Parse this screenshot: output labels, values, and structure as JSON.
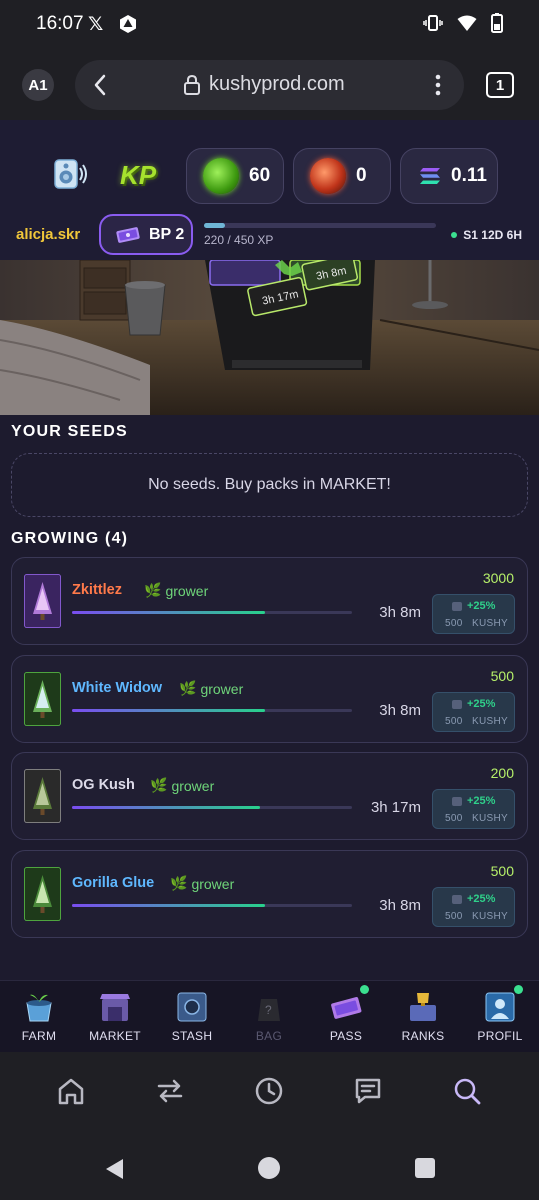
{
  "status_bar": {
    "time": "16:07",
    "x_icon": "x-icon"
  },
  "browser": {
    "profile": "A1",
    "url": "kushyprod.com",
    "tab_count": "1"
  },
  "header": {
    "logo_text": "KP",
    "currencies": [
      {
        "icon": "kp-green-coin",
        "value": "60"
      },
      {
        "icon": "kp-red-coin",
        "value": "0"
      },
      {
        "icon": "solana-icon",
        "value": "0.11"
      }
    ],
    "username": "alicja.skr",
    "bp_label": "BP 2",
    "xp_text": "220 / 450 XP",
    "xp_progress": 0.0888,
    "season": "S1 12D 6H"
  },
  "banner": {
    "tile_1": "3h 17m",
    "tile_2": "3h 8m"
  },
  "seeds": {
    "title": "YOUR SEEDS",
    "empty_message": "No seeds. Buy packs in MARKET!"
  },
  "growing": {
    "title": "GROWING (4)",
    "items": [
      {
        "name": "Zkittlez",
        "name_color": "#ff7a4a",
        "role": "grower",
        "time": "3h 8m",
        "reward": "3000",
        "boost_pct": "+25%",
        "boost_amount": "500",
        "boost_unit": "KUSHY",
        "progress": 0.69
      },
      {
        "name": "White Widow",
        "name_color": "#5fb8ff",
        "role": "grower",
        "time": "3h 8m",
        "reward": "500",
        "boost_pct": "+25%",
        "boost_amount": "500",
        "boost_unit": "KUSHY",
        "progress": 0.69
      },
      {
        "name": "OG Kush",
        "name_color": "#dcdae8",
        "role": "grower",
        "time": "3h 17m",
        "reward": "200",
        "boost_pct": "+25%",
        "boost_amount": "500",
        "boost_unit": "KUSHY",
        "progress": 0.67
      },
      {
        "name": "Gorilla Glue",
        "name_color": "#5fb8ff",
        "role": "grower",
        "time": "3h 8m",
        "reward": "500",
        "boost_pct": "+25%",
        "boost_amount": "500",
        "boost_unit": "KUSHY",
        "progress": 0.69
      }
    ]
  },
  "nav": {
    "items": [
      {
        "label": "FARM",
        "icon": "farm-icon",
        "active": true
      },
      {
        "label": "MARKET",
        "icon": "market-icon"
      },
      {
        "label": "STASH",
        "icon": "stash-icon"
      },
      {
        "label": "BAG",
        "icon": "bag-icon",
        "disabled": true
      },
      {
        "label": "PASS",
        "icon": "pass-icon",
        "notification": true
      },
      {
        "label": "RANKS",
        "icon": "ranks-icon"
      },
      {
        "label": "PROFIL",
        "icon": "profile-icon",
        "notification": true
      }
    ]
  },
  "colors": {
    "accent": "#8a5cf0",
    "reward": "#b6f06a",
    "boost": "#2fd08a",
    "username": "#f0c63a"
  }
}
